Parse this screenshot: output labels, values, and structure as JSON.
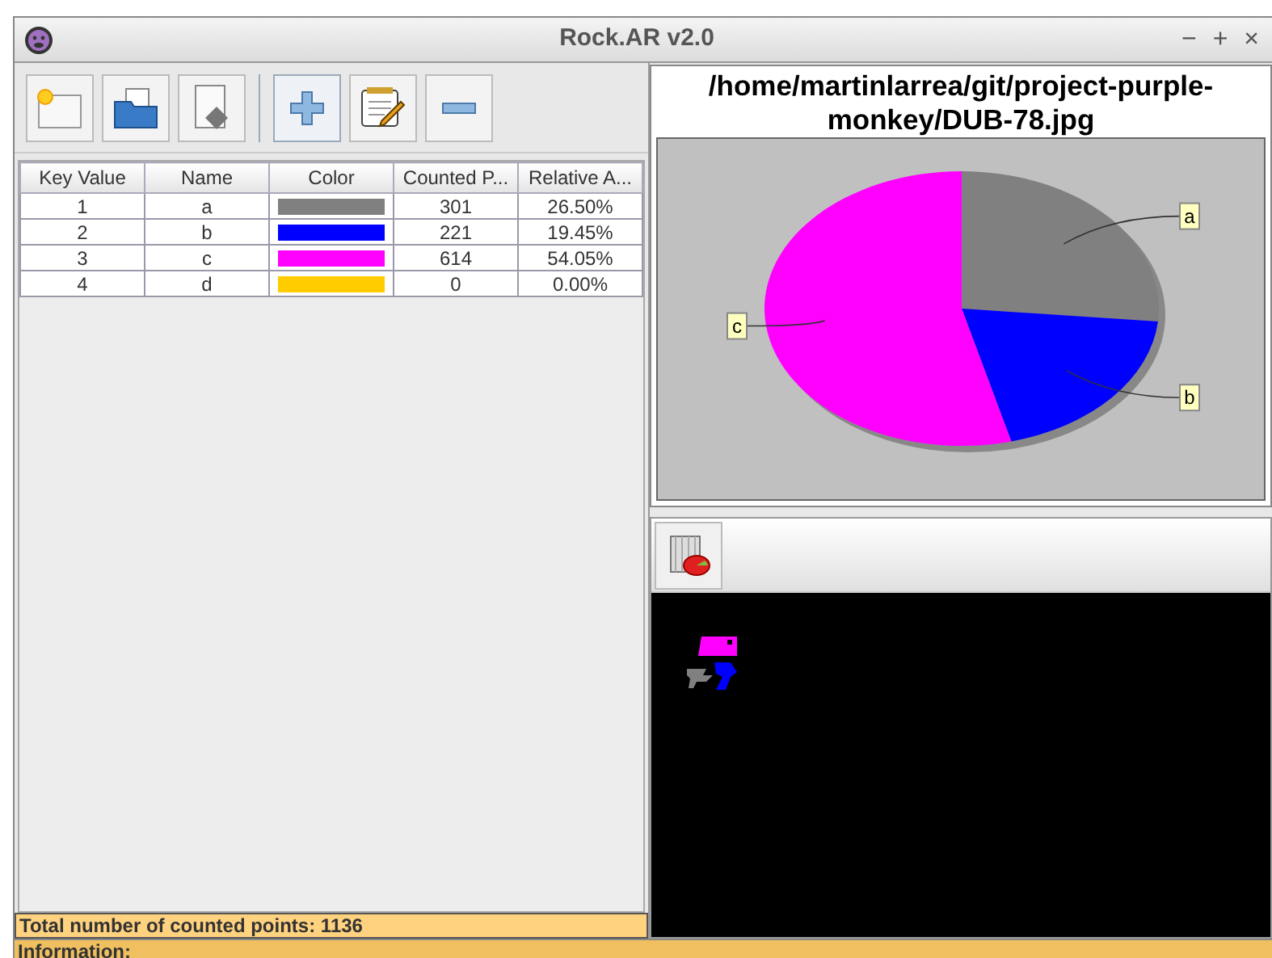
{
  "window": {
    "title": "Rock.AR v2.0",
    "controls": [
      "−",
      "+",
      "×"
    ]
  },
  "table": {
    "columns": [
      "Key Value",
      "Name",
      "Color",
      "Counted P...",
      "Relative A..."
    ],
    "rows": [
      {
        "key": "1",
        "name": "a",
        "color": "#808080",
        "counted": "301",
        "relative": "26.50%"
      },
      {
        "key": "2",
        "name": "b",
        "color": "#0000ff",
        "counted": "221",
        "relative": "19.45%"
      },
      {
        "key": "3",
        "name": "c",
        "color": "#ff00ff",
        "counted": "614",
        "relative": "54.05%"
      },
      {
        "key": "4",
        "name": "d",
        "color": "#ffcc00",
        "counted": "0",
        "relative": "0.00%"
      }
    ]
  },
  "total": "Total number of counted points: 1136",
  "information": "Information:",
  "image_path": "/home/martinlarrea/git/project-purple-monkey/DUB-78.jpg",
  "chart": {
    "chart_data": {
      "type": "pie",
      "categories": [
        "a",
        "b",
        "c"
      ],
      "values": [
        26.5,
        19.45,
        54.05
      ],
      "colors": [
        "#808080",
        "#0000ff",
        "#ff00ff"
      ]
    }
  }
}
